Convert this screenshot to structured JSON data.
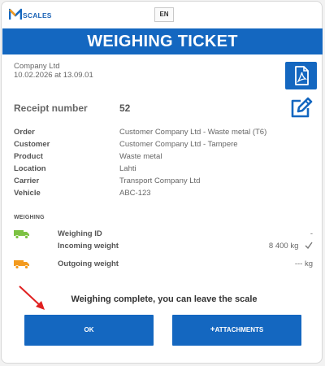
{
  "brand": {
    "logo_text": "SCALES",
    "accent": "#1467c0",
    "logo_orange": "#f39a1d"
  },
  "header": {
    "language": "EN",
    "title": "WEIGHING TICKET"
  },
  "company": {
    "name": "Company Ltd",
    "datetime": "10.02.2026 at 13.09.01"
  },
  "receipt": {
    "label": "Receipt number",
    "value": "52"
  },
  "info": [
    {
      "key": "Order",
      "value": "Customer Company Ltd - Waste metal (T6)"
    },
    {
      "key": "Customer",
      "value": "Customer Company Ltd - Tampere"
    },
    {
      "key": "Product",
      "value": "Waste metal"
    },
    {
      "key": "Location",
      "value": "Lahti"
    },
    {
      "key": "Carrier",
      "value": "Transport Company Ltd"
    },
    {
      "key": "Vehicle",
      "value": "ABC-123"
    }
  ],
  "weighing": {
    "section_label": "WEIGHING",
    "id": {
      "label": "Weighing ID",
      "value": "-"
    },
    "incoming": {
      "label": "Incoming weight",
      "value": "8 400 kg",
      "status_icon": "check-icon",
      "truck_color": "#7cc242"
    },
    "outgoing": {
      "label": "Outgoing weight",
      "value": "--- kg",
      "truck_color": "#f39a1d"
    }
  },
  "footer": {
    "message": "Weighing complete, you can leave the scale",
    "ok_label": "OK",
    "attachments_label": "ATTACHMENTS",
    "attachments_icon": "plus-icon"
  },
  "annotation": {
    "arrow_color": "#e02020"
  }
}
